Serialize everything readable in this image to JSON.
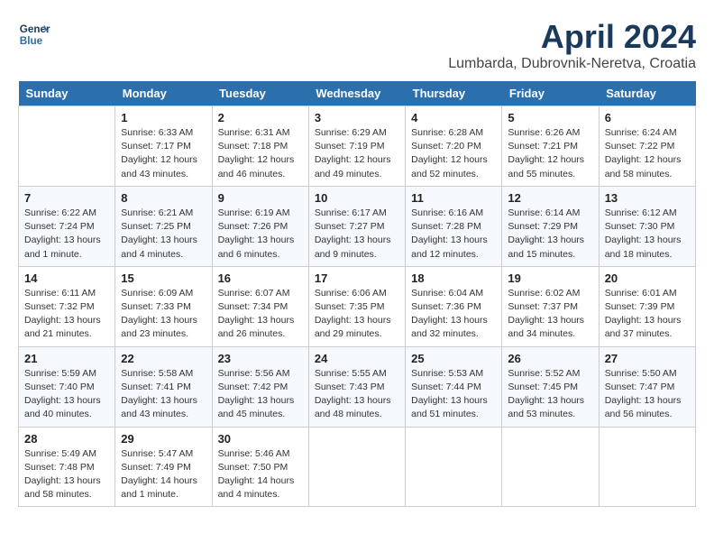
{
  "header": {
    "logo_line1": "General",
    "logo_line2": "Blue",
    "title": "April 2024",
    "location": "Lumbarda, Dubrovnik-Neretva, Croatia"
  },
  "weekdays": [
    "Sunday",
    "Monday",
    "Tuesday",
    "Wednesday",
    "Thursday",
    "Friday",
    "Saturday"
  ],
  "weeks": [
    [
      {
        "day": "",
        "sunrise": "",
        "sunset": "",
        "daylight": ""
      },
      {
        "day": "1",
        "sunrise": "Sunrise: 6:33 AM",
        "sunset": "Sunset: 7:17 PM",
        "daylight": "Daylight: 12 hours and 43 minutes."
      },
      {
        "day": "2",
        "sunrise": "Sunrise: 6:31 AM",
        "sunset": "Sunset: 7:18 PM",
        "daylight": "Daylight: 12 hours and 46 minutes."
      },
      {
        "day": "3",
        "sunrise": "Sunrise: 6:29 AM",
        "sunset": "Sunset: 7:19 PM",
        "daylight": "Daylight: 12 hours and 49 minutes."
      },
      {
        "day": "4",
        "sunrise": "Sunrise: 6:28 AM",
        "sunset": "Sunset: 7:20 PM",
        "daylight": "Daylight: 12 hours and 52 minutes."
      },
      {
        "day": "5",
        "sunrise": "Sunrise: 6:26 AM",
        "sunset": "Sunset: 7:21 PM",
        "daylight": "Daylight: 12 hours and 55 minutes."
      },
      {
        "day": "6",
        "sunrise": "Sunrise: 6:24 AM",
        "sunset": "Sunset: 7:22 PM",
        "daylight": "Daylight: 12 hours and 58 minutes."
      }
    ],
    [
      {
        "day": "7",
        "sunrise": "Sunrise: 6:22 AM",
        "sunset": "Sunset: 7:24 PM",
        "daylight": "Daylight: 13 hours and 1 minute."
      },
      {
        "day": "8",
        "sunrise": "Sunrise: 6:21 AM",
        "sunset": "Sunset: 7:25 PM",
        "daylight": "Daylight: 13 hours and 4 minutes."
      },
      {
        "day": "9",
        "sunrise": "Sunrise: 6:19 AM",
        "sunset": "Sunset: 7:26 PM",
        "daylight": "Daylight: 13 hours and 6 minutes."
      },
      {
        "day": "10",
        "sunrise": "Sunrise: 6:17 AM",
        "sunset": "Sunset: 7:27 PM",
        "daylight": "Daylight: 13 hours and 9 minutes."
      },
      {
        "day": "11",
        "sunrise": "Sunrise: 6:16 AM",
        "sunset": "Sunset: 7:28 PM",
        "daylight": "Daylight: 13 hours and 12 minutes."
      },
      {
        "day": "12",
        "sunrise": "Sunrise: 6:14 AM",
        "sunset": "Sunset: 7:29 PM",
        "daylight": "Daylight: 13 hours and 15 minutes."
      },
      {
        "day": "13",
        "sunrise": "Sunrise: 6:12 AM",
        "sunset": "Sunset: 7:30 PM",
        "daylight": "Daylight: 13 hours and 18 minutes."
      }
    ],
    [
      {
        "day": "14",
        "sunrise": "Sunrise: 6:11 AM",
        "sunset": "Sunset: 7:32 PM",
        "daylight": "Daylight: 13 hours and 21 minutes."
      },
      {
        "day": "15",
        "sunrise": "Sunrise: 6:09 AM",
        "sunset": "Sunset: 7:33 PM",
        "daylight": "Daylight: 13 hours and 23 minutes."
      },
      {
        "day": "16",
        "sunrise": "Sunrise: 6:07 AM",
        "sunset": "Sunset: 7:34 PM",
        "daylight": "Daylight: 13 hours and 26 minutes."
      },
      {
        "day": "17",
        "sunrise": "Sunrise: 6:06 AM",
        "sunset": "Sunset: 7:35 PM",
        "daylight": "Daylight: 13 hours and 29 minutes."
      },
      {
        "day": "18",
        "sunrise": "Sunrise: 6:04 AM",
        "sunset": "Sunset: 7:36 PM",
        "daylight": "Daylight: 13 hours and 32 minutes."
      },
      {
        "day": "19",
        "sunrise": "Sunrise: 6:02 AM",
        "sunset": "Sunset: 7:37 PM",
        "daylight": "Daylight: 13 hours and 34 minutes."
      },
      {
        "day": "20",
        "sunrise": "Sunrise: 6:01 AM",
        "sunset": "Sunset: 7:39 PM",
        "daylight": "Daylight: 13 hours and 37 minutes."
      }
    ],
    [
      {
        "day": "21",
        "sunrise": "Sunrise: 5:59 AM",
        "sunset": "Sunset: 7:40 PM",
        "daylight": "Daylight: 13 hours and 40 minutes."
      },
      {
        "day": "22",
        "sunrise": "Sunrise: 5:58 AM",
        "sunset": "Sunset: 7:41 PM",
        "daylight": "Daylight: 13 hours and 43 minutes."
      },
      {
        "day": "23",
        "sunrise": "Sunrise: 5:56 AM",
        "sunset": "Sunset: 7:42 PM",
        "daylight": "Daylight: 13 hours and 45 minutes."
      },
      {
        "day": "24",
        "sunrise": "Sunrise: 5:55 AM",
        "sunset": "Sunset: 7:43 PM",
        "daylight": "Daylight: 13 hours and 48 minutes."
      },
      {
        "day": "25",
        "sunrise": "Sunrise: 5:53 AM",
        "sunset": "Sunset: 7:44 PM",
        "daylight": "Daylight: 13 hours and 51 minutes."
      },
      {
        "day": "26",
        "sunrise": "Sunrise: 5:52 AM",
        "sunset": "Sunset: 7:45 PM",
        "daylight": "Daylight: 13 hours and 53 minutes."
      },
      {
        "day": "27",
        "sunrise": "Sunrise: 5:50 AM",
        "sunset": "Sunset: 7:47 PM",
        "daylight": "Daylight: 13 hours and 56 minutes."
      }
    ],
    [
      {
        "day": "28",
        "sunrise": "Sunrise: 5:49 AM",
        "sunset": "Sunset: 7:48 PM",
        "daylight": "Daylight: 13 hours and 58 minutes."
      },
      {
        "day": "29",
        "sunrise": "Sunrise: 5:47 AM",
        "sunset": "Sunset: 7:49 PM",
        "daylight": "Daylight: 14 hours and 1 minute."
      },
      {
        "day": "30",
        "sunrise": "Sunrise: 5:46 AM",
        "sunset": "Sunset: 7:50 PM",
        "daylight": "Daylight: 14 hours and 4 minutes."
      },
      {
        "day": "",
        "sunrise": "",
        "sunset": "",
        "daylight": ""
      },
      {
        "day": "",
        "sunrise": "",
        "sunset": "",
        "daylight": ""
      },
      {
        "day": "",
        "sunrise": "",
        "sunset": "",
        "daylight": ""
      },
      {
        "day": "",
        "sunrise": "",
        "sunset": "",
        "daylight": ""
      }
    ]
  ]
}
